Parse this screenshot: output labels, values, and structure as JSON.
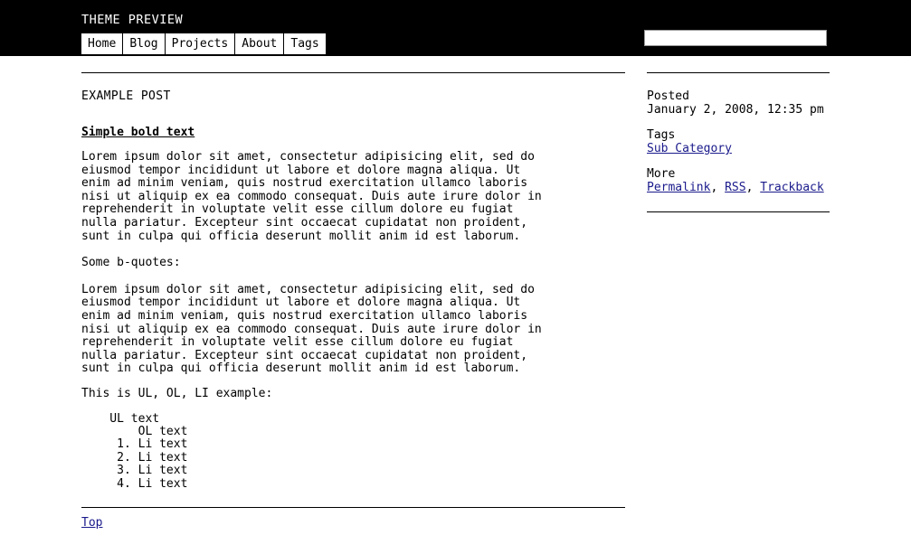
{
  "header": {
    "site_title": "THEME PREVIEW",
    "nav": [
      {
        "label": "Home",
        "name": "home"
      },
      {
        "label": "Blog",
        "name": "blog"
      },
      {
        "label": "Projects",
        "name": "projects"
      },
      {
        "label": "About",
        "name": "about"
      },
      {
        "label": "Tags",
        "name": "tags"
      }
    ],
    "search": {
      "value": "",
      "placeholder": ""
    }
  },
  "main": {
    "post_title": "EXAMPLE POST",
    "post_subtitle": "Simple bold text",
    "paragraph_1": "Lorem ipsum dolor sit amet, consectetur adipisicing elit, sed do\neiusmod tempor incididunt ut labore et dolore magna aliqua. Ut\nenim ad minim veniam, quis nostrud exercitation ullamco laboris\nnisi ut aliquip ex ea commodo consequat. Duis aute irure dolor in\nreprehenderit in voluptate velit esse cillum dolore eu fugiat\nnulla pariatur. Excepteur sint occaecat cupidatat non proident,\nsunt in culpa qui officia deserunt mollit anim id est laborum.",
    "blockquote_intro": "Some b-quotes:",
    "paragraph_2": "Lorem ipsum dolor sit amet, consectetur adipisicing elit, sed do\neiusmod tempor incididunt ut labore et dolore magna aliqua. Ut\nenim ad minim veniam, quis nostrud exercitation ullamco laboris\nnisi ut aliquip ex ea commodo consequat. Duis aute irure dolor in\nreprehenderit in voluptate velit esse cillum dolore eu fugiat\nnulla pariatur. Excepteur sint occaecat cupidatat non proident,\nsunt in culpa qui officia deserunt mollit anim id est laborum.",
    "list_intro": "This is UL, OL, LI example:",
    "list_lines": [
      "    UL text",
      "        OL text",
      "     1. Li text",
      "     2. Li text",
      "     3. Li text",
      "     4. Li text"
    ],
    "top_link": "Top"
  },
  "sidebar": {
    "posted_label": "Posted",
    "posted_value": "January 2, 2008, 12:35 pm",
    "tags_label": "Tags",
    "tags_link": "Sub Category",
    "more_label": "More",
    "more_links": [
      {
        "label": "Permalink",
        "name": "permalink"
      },
      {
        "label": "RSS",
        "name": "rss"
      },
      {
        "label": "Trackback",
        "name": "trackback"
      }
    ],
    "more_separator": ", "
  },
  "colors": {
    "header_background": "#000000",
    "header_text": "#ffffff",
    "page_background": "#ffffff",
    "body_text": "#000000",
    "link": "#1a1a8c"
  }
}
